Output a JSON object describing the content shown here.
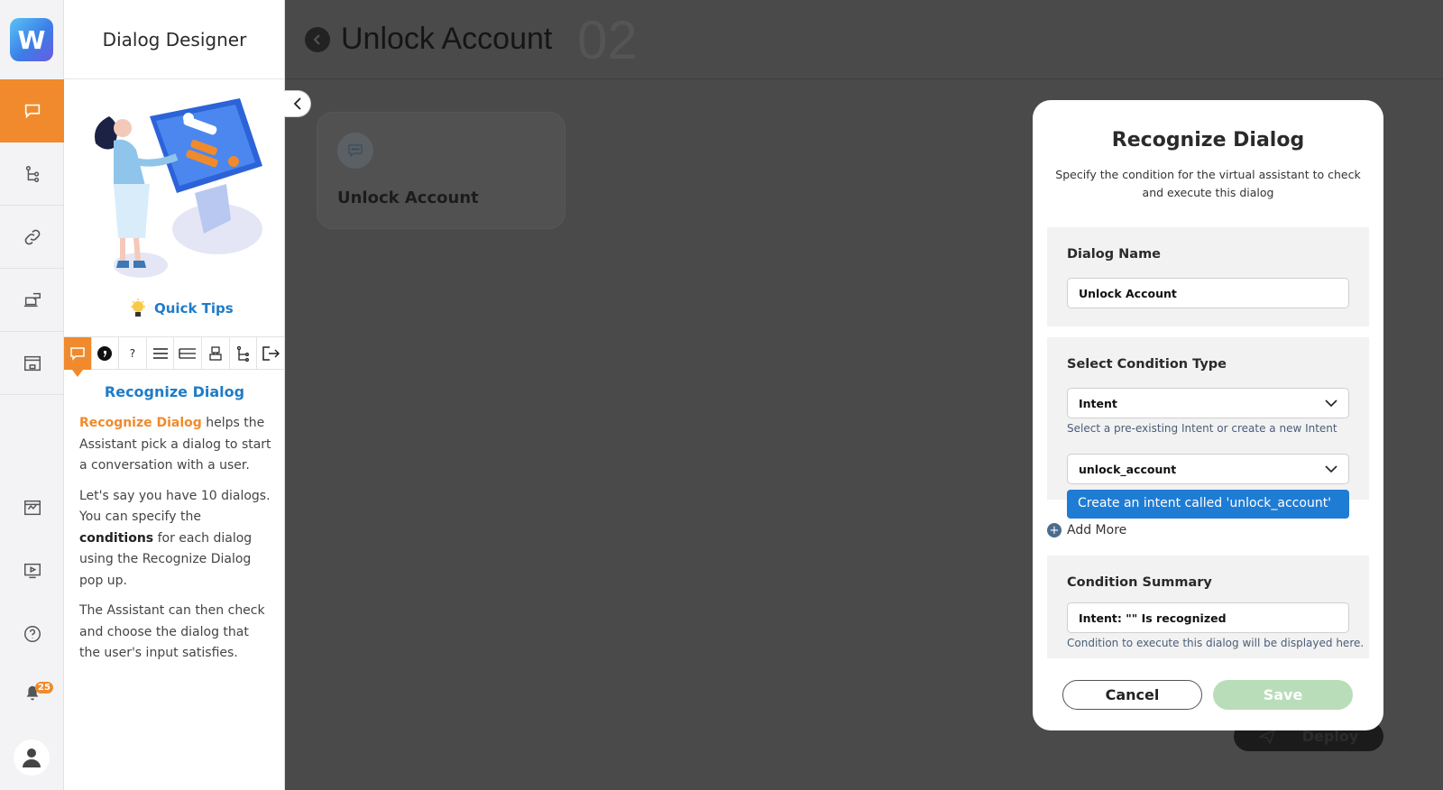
{
  "app": {
    "logo_letter": "W",
    "panel_title": "Dialog Designer",
    "notification_count": "25"
  },
  "sidebar": {
    "quick_tips_label": "Quick Tips",
    "tip_tabs": [
      "chat",
      "quote",
      "?",
      "list",
      "rows",
      "robot",
      "tree",
      "exit"
    ],
    "tip": {
      "heading": "Recognize Dialog",
      "p1_highlight": "Recognize Dialog",
      "p1_rest": " helps the Assistant pick a dialog to start a conversation with a user.",
      "p2_before": "Let's say you have 10 dialogs. You can specify the ",
      "p2_bold": "conditions",
      "p2_after": " for each dialog using the Recognize Dialog pop up.",
      "p3": "The Assistant can then check and choose the dialog that the user's input satisfies."
    }
  },
  "main": {
    "title": "Unlock Account",
    "ghost_number": "02",
    "card_label": "Unlock Account",
    "deploy_label": "Deploy"
  },
  "modal": {
    "title": "Recognize Dialog",
    "subtitle": "Specify the condition for the virtual assistant to check and execute this dialog",
    "dialog_name_label": "Dialog Name",
    "dialog_name_value": "Unlock Account",
    "condition_type_label": "Select Condition Type",
    "condition_type_value": "Intent",
    "condition_type_hint": "Select a pre-existing Intent or create a new Intent",
    "intent_value": "unlock_account",
    "suggestion": "Create an intent called 'unlock_account'",
    "add_more": "Add More",
    "summary_label": "Condition Summary",
    "summary_value": "Intent: \"\" Is recognized",
    "summary_hint": "Condition to execute this dialog will be displayed here.",
    "cancel": "Cancel",
    "save": "Save"
  },
  "colors": {
    "accent": "#f08a2c",
    "link": "#1f7cc7",
    "overlay": "#4a4a4a",
    "save_disabled": "#b9ddb8"
  }
}
